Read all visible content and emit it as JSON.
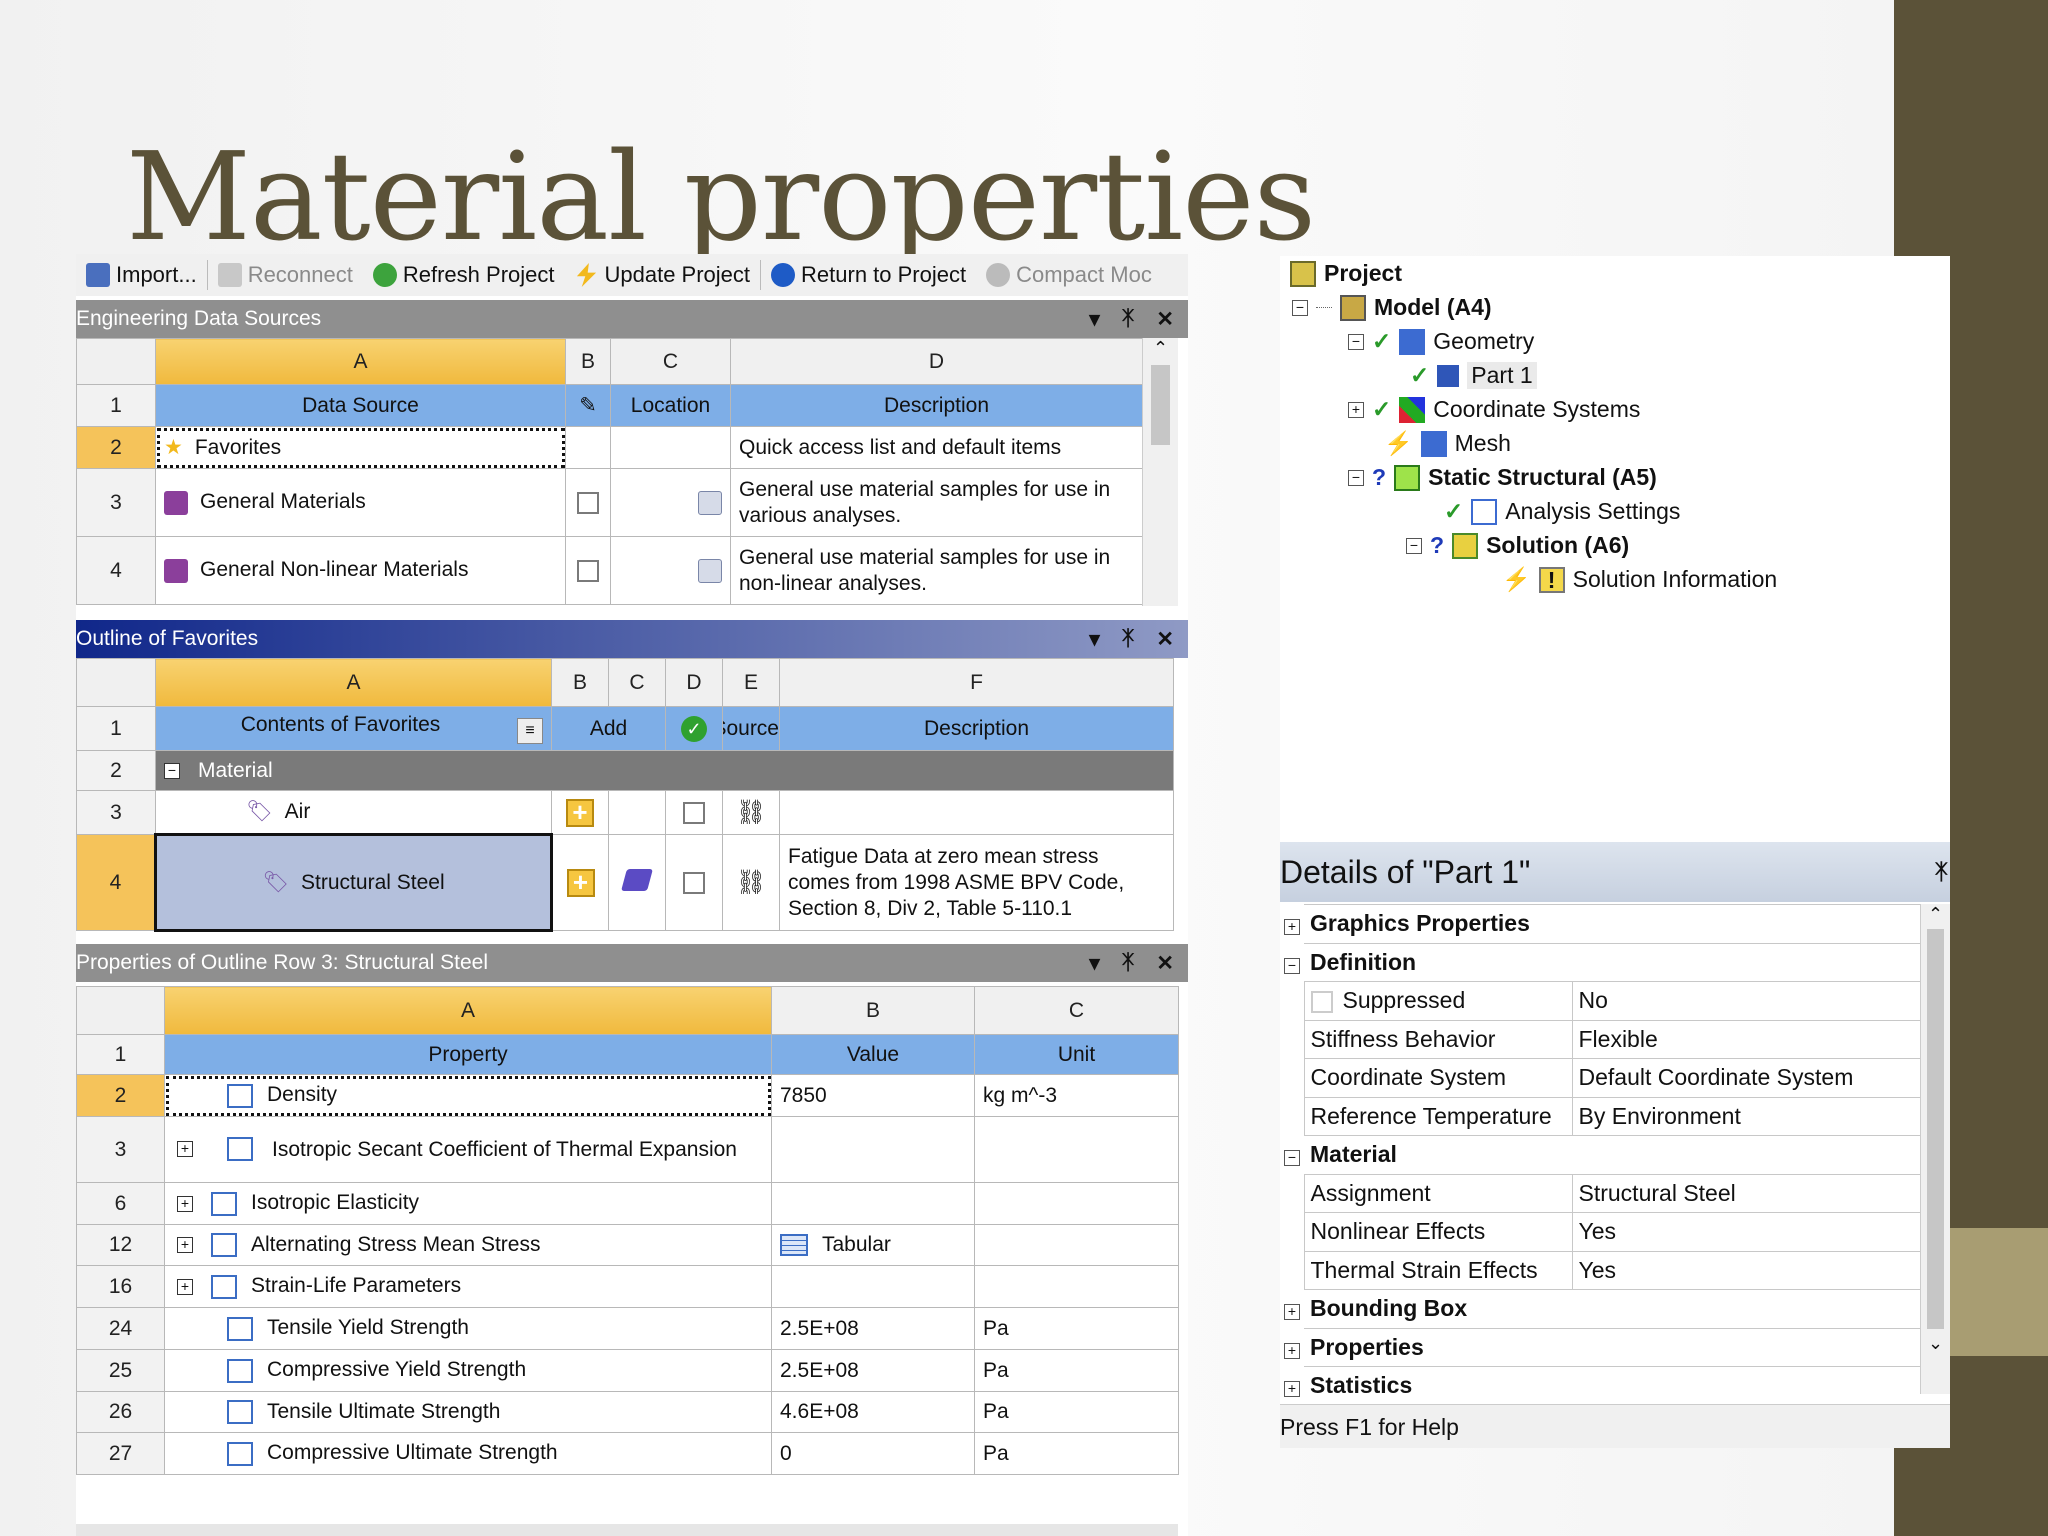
{
  "slide_title": "Material properties",
  "toolbar": {
    "import": "Import...",
    "reconnect": "Reconnect",
    "refresh": "Refresh Project",
    "update": "Update Project",
    "return": "Return to Project",
    "compact": "Compact Moc"
  },
  "eds": {
    "title": "Engineering Data Sources",
    "cols": [
      "A",
      "B",
      "C",
      "D"
    ],
    "headers": {
      "a": "Data Source",
      "c": "Location",
      "d": "Description"
    },
    "rows": [
      {
        "n": "2",
        "name": "Favorites",
        "desc": "Quick access list and default items"
      },
      {
        "n": "3",
        "name": "General Materials",
        "desc": "General use material samples for use in various analyses."
      },
      {
        "n": "4",
        "name": "General Non-linear Materials",
        "desc": "General use material samples for use in non-linear analyses."
      }
    ],
    "header_row": "1"
  },
  "outline": {
    "title": "Outline of Favorites",
    "cols": [
      "A",
      "B",
      "C",
      "D",
      "E",
      "F"
    ],
    "headers": {
      "a": "Contents of Favorites",
      "b": "Add",
      "e": "Source",
      "f": "Description"
    },
    "rows": [
      {
        "n": "1"
      },
      {
        "n": "2",
        "name": "Material"
      },
      {
        "n": "3",
        "name": "Air"
      },
      {
        "n": "4",
        "name": "Structural Steel",
        "desc": "Fatigue Data at zero mean stress comes from 1998 ASME BPV Code, Section 8, Div 2, Table 5-110.1"
      }
    ]
  },
  "props": {
    "title": "Properties of Outline Row 3: Structural Steel",
    "cols": [
      "A",
      "B",
      "C"
    ],
    "headers": {
      "a": "Property",
      "b": "Value",
      "c": "Unit"
    },
    "rows": [
      {
        "n": "1"
      },
      {
        "n": "2",
        "name": "Density",
        "value": "7850",
        "unit": "kg m^-3"
      },
      {
        "n": "3",
        "name": "Isotropic Secant Coefficient of Thermal Expansion",
        "value": "",
        "unit": ""
      },
      {
        "n": "6",
        "name": "Isotropic Elasticity",
        "value": "",
        "unit": ""
      },
      {
        "n": "12",
        "name": "Alternating Stress Mean Stress",
        "value": "Tabular",
        "unit": ""
      },
      {
        "n": "16",
        "name": "Strain-Life Parameters",
        "value": "",
        "unit": ""
      },
      {
        "n": "24",
        "name": "Tensile Yield Strength",
        "value": "2.5E+08",
        "unit": "Pa"
      },
      {
        "n": "25",
        "name": "Compressive Yield Strength",
        "value": "2.5E+08",
        "unit": "Pa"
      },
      {
        "n": "26",
        "name": "Tensile Ultimate Strength",
        "value": "4.6E+08",
        "unit": "Pa"
      },
      {
        "n": "27",
        "name": "Compressive Ultimate Strength",
        "value": "0",
        "unit": "Pa"
      }
    ]
  },
  "tree": {
    "project": "Project",
    "model": "Model (A4)",
    "geometry": "Geometry",
    "part": "Part 1",
    "coords": "Coordinate Systems",
    "mesh": "Mesh",
    "static": "Static Structural (A5)",
    "analysis": "Analysis Settings",
    "solution": "Solution (A6)",
    "solinfo": "Solution Information"
  },
  "details": {
    "title": "Details of \"Part 1\"",
    "graphics": "Graphics Properties",
    "definition": "Definition",
    "def_rows": [
      {
        "k": "Suppressed",
        "v": "No"
      },
      {
        "k": "Stiffness Behavior",
        "v": "Flexible"
      },
      {
        "k": "Coordinate System",
        "v": "Default Coordinate System"
      },
      {
        "k": "Reference Temperature",
        "v": "By Environment"
      }
    ],
    "material": "Material",
    "mat_rows": [
      {
        "k": "Assignment",
        "v": "Structural Steel"
      },
      {
        "k": "Nonlinear Effects",
        "v": "Yes"
      },
      {
        "k": "Thermal Strain Effects",
        "v": "Yes"
      }
    ],
    "bbox": "Bounding Box",
    "properties": "Properties",
    "statistics": "Statistics",
    "status": "Press F1 for Help"
  },
  "colors": {
    "accent": "#5b5238",
    "header_blue": "#7eaee7",
    "selected": "#f5c35a"
  }
}
